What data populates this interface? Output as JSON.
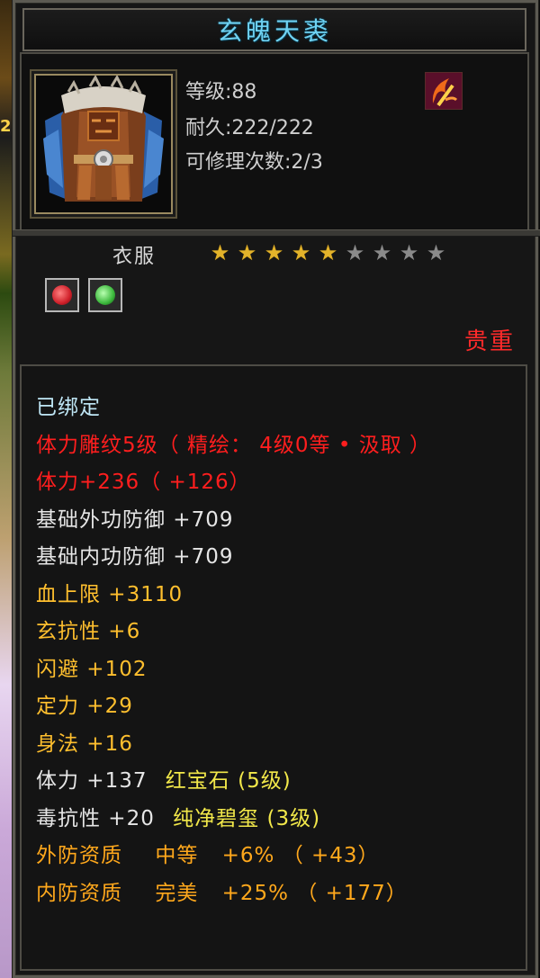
{
  "item": {
    "name": "玄魄天裘",
    "level_text": "等级:88",
    "durability_text": "耐久:222/222",
    "repair_text": "可修理次数:2/3",
    "slot": "衣服",
    "stars_total": 9,
    "stars_filled": 5,
    "rarity": "贵重",
    "gems": [
      {
        "name": "red-gem",
        "color": "#d0202a"
      },
      {
        "name": "green-gem",
        "color": "#3cb83c"
      }
    ]
  },
  "stats": {
    "bound": "已绑定",
    "carving": "体力雕纹5级（ 精绘： 4级0等 • 汲取 ）",
    "stamina_bonus": "体力+236（ +126）",
    "ext_def": "基础外功防御 +709",
    "int_def": "基础内功防御 +709",
    "hp_max": "血上限 +3110",
    "xuan_resist": "玄抗性 +6",
    "dodge": "闪避 +102",
    "focus": "定力 +29",
    "agility": "身法 +16",
    "gem1_stat": "体力 +137",
    "gem1_name": "红宝石 (5级)",
    "gem2_stat": "毒抗性 +20",
    "gem2_name": "纯净碧玺 (3级)",
    "ext_quality_label": "外防资质",
    "ext_quality_grade": "中等",
    "ext_quality_value": "+6% （ +43）",
    "int_quality_label": "内防资质",
    "int_quality_grade": "完美",
    "int_quality_value": "+25% （ +177）"
  },
  "colors": {
    "title": "#6fd2f2",
    "rarity": "#ff2a2a",
    "bound": "#bfe6f5",
    "carving": "#ff1e1e",
    "attribute": "#ffbf2e",
    "gem_name": "#f2e84a",
    "quality": "#ffa81c"
  },
  "icons": {
    "portrait": "fur-robe-armor-icon",
    "weapon": "sickle-weapon-icon"
  }
}
